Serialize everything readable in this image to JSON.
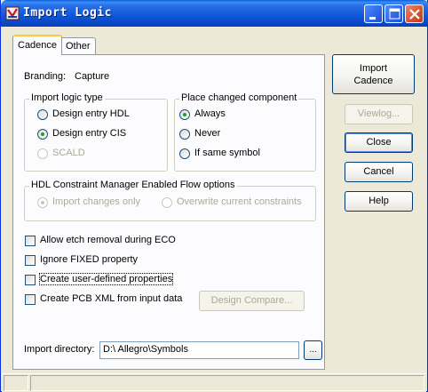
{
  "window": {
    "title": "Import Logic"
  },
  "tabs": [
    {
      "label": "Cadence",
      "active": true
    },
    {
      "label": "Other",
      "active": false
    }
  ],
  "branding": {
    "label": "Branding:",
    "value": "Capture"
  },
  "logic_type": {
    "title": "Import logic type",
    "options": [
      {
        "label": "Design entry HDL",
        "selected": false,
        "enabled": true
      },
      {
        "label": "Design entry CIS",
        "selected": true,
        "enabled": true
      },
      {
        "label": "SCALD",
        "selected": false,
        "enabled": false
      }
    ]
  },
  "place_changed": {
    "title": "Place changed component",
    "options": [
      {
        "label": "Always",
        "selected": true
      },
      {
        "label": "Never",
        "selected": false
      },
      {
        "label": "If same symbol",
        "selected": false
      }
    ]
  },
  "hdl_flow": {
    "title": "HDL Constraint Manager Enabled Flow options",
    "options": [
      {
        "label": "Import changes only",
        "selected": true,
        "enabled": false
      },
      {
        "label": "Overwrite current constraints",
        "selected": false,
        "enabled": false
      }
    ]
  },
  "checkboxes": [
    {
      "label": "Allow etch removal during ECO",
      "checked": false
    },
    {
      "label": "Ignore FIXED property",
      "checked": false
    },
    {
      "label": "Create user-defined properties",
      "checked": false
    },
    {
      "label": "Create PCB XML from input data",
      "checked": false
    }
  ],
  "design_compare_button": "Design Compare...",
  "import_directory": {
    "label": "Import directory:",
    "value": "D:\\ Allegro\\Symbols",
    "browse_label": "..."
  },
  "side_buttons": {
    "import_line1": "Import",
    "import_line2": "Cadence",
    "viewlog": "Viewlog...",
    "close": "Close",
    "cancel": "Cancel",
    "help": "Help"
  },
  "colors": {
    "title_bar": "#0a49c7",
    "face": "#ece9d8",
    "radio_dot": "#21a121",
    "close_button": "#d5532f"
  }
}
